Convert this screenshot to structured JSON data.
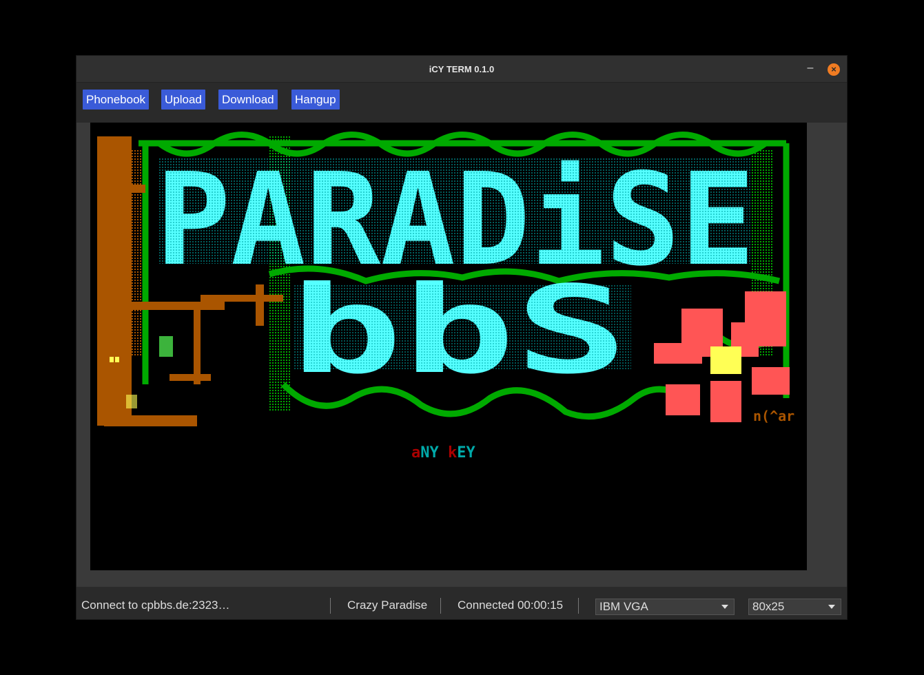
{
  "window": {
    "title": "iCY TERM 0.1.0",
    "minimize_glyph": "–",
    "close_glyph": "×"
  },
  "toolbar": {
    "phonebook": "Phonebook",
    "upload": "Upload",
    "download": "Download",
    "hangup": "Hangup"
  },
  "terminal": {
    "art_line1": "PARADiSE",
    "art_line2": "bbS",
    "artist_tag": "n(^ar",
    "prompt_part1": "a",
    "prompt_part2": "NY ",
    "prompt_part3": "k",
    "prompt_part4": "EY"
  },
  "status": {
    "connect_text": "Connect to cpbbs.de:2323…",
    "bbs_name": "Crazy Paradise",
    "connected_time": "Connected 00:00:15",
    "font_selected": "IBM VGA",
    "screen_mode": "80x25"
  },
  "colors": {
    "accent": "#3a5bd8",
    "close": "#f07c22",
    "art_cyan": "#55ffff",
    "art_teal": "#00aaaa",
    "art_green": "#00aa00",
    "art_brown": "#aa5500",
    "art_red": "#ff5555",
    "art_yellow": "#ffff55"
  }
}
